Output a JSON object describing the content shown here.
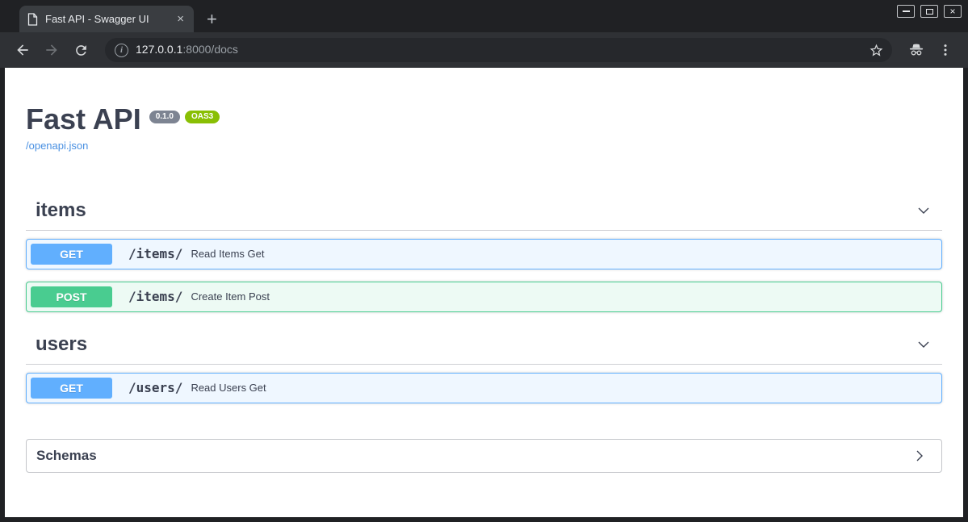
{
  "browser": {
    "tab_title": "Fast API - Swagger UI",
    "url_host": "127.0.0.1",
    "url_rest": ":8000/docs",
    "icons": {
      "tab_close": "×",
      "new_tab": "+",
      "window_close": "×"
    }
  },
  "page": {
    "title": "Fast API",
    "version_badge": "0.1.0",
    "oas_badge": "OAS3",
    "spec_link": "/openapi.json",
    "sections": [
      {
        "title": "items",
        "operations": [
          {
            "method": "GET",
            "path": "/items/",
            "summary": "Read Items Get"
          },
          {
            "method": "POST",
            "path": "/items/",
            "summary": "Create Item Post"
          }
        ]
      },
      {
        "title": "users",
        "operations": [
          {
            "method": "GET",
            "path": "/users/",
            "summary": "Read Users Get"
          }
        ]
      }
    ],
    "schemas_title": "Schemas"
  },
  "colors": {
    "get": "#61affe",
    "post": "#49cc90",
    "get_row_bg": "#eff7ff",
    "post_row_bg": "#edfaf4",
    "link": "#4990e2",
    "text": "#3b4151",
    "version_badge_bg": "#7d8492",
    "oas_badge_bg": "#89bf04",
    "frame": "#202124",
    "toolbar": "#2f3135"
  }
}
